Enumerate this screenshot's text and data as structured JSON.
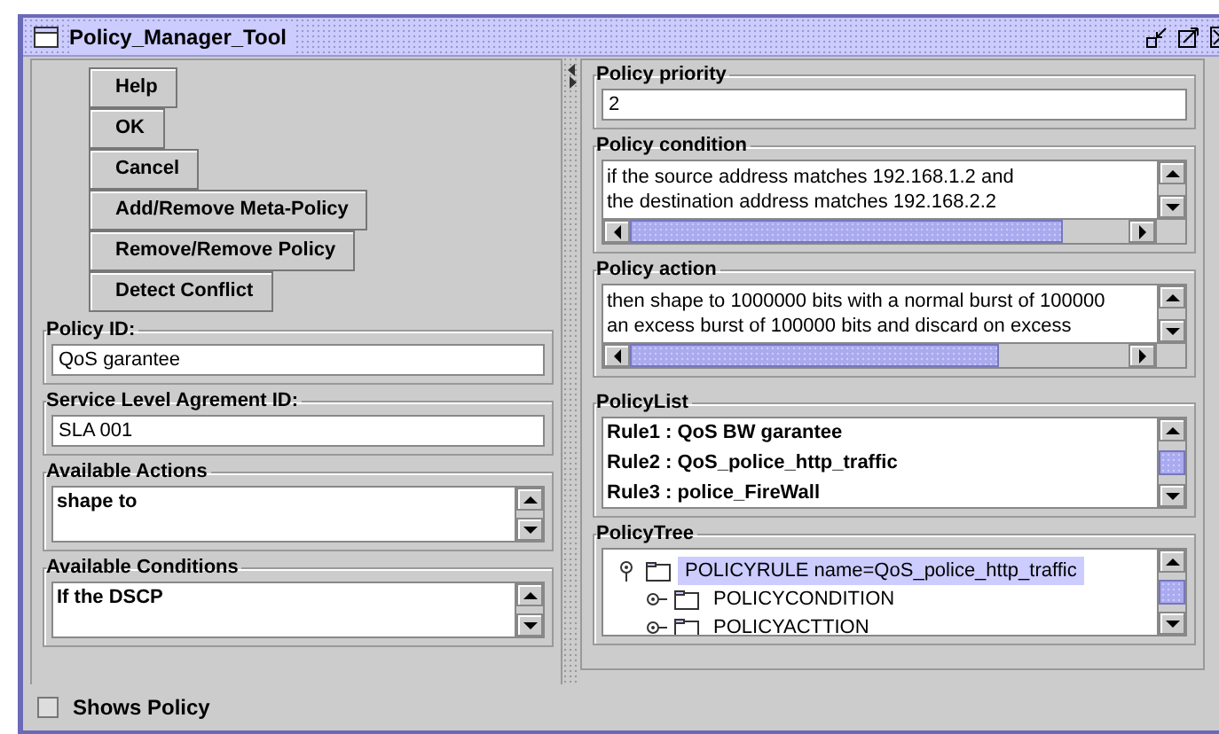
{
  "window": {
    "title": "Policy_Manager_Tool"
  },
  "buttons": [
    {
      "label": "Help"
    },
    {
      "label": "OK"
    },
    {
      "label": "Cancel"
    },
    {
      "label": "Add/Remove Meta-Policy"
    },
    {
      "label": "Remove/Remove Policy"
    },
    {
      "label": "Detect Conflict"
    }
  ],
  "policy_id": {
    "label": "Policy ID:",
    "value": "QoS garantee"
  },
  "sla_id": {
    "label": "Service Level Agrement ID:",
    "value": "SLA 001"
  },
  "available_actions": {
    "label": "Available Actions",
    "items": [
      "shape to"
    ]
  },
  "available_conditions": {
    "label": "Available Conditions",
    "items": [
      "If the DSCP"
    ]
  },
  "policy_priority": {
    "label": "Policy priority",
    "value": "2"
  },
  "policy_condition": {
    "label": "Policy condition",
    "lines": [
      "if the source address matches 192.168.1.2 and",
      "the destination address matches 192.168.2.2"
    ]
  },
  "policy_action": {
    "label": "Policy action",
    "lines": [
      "then shape to 1000000 bits with a normal burst of 100000",
      "an excess burst of 100000 bits and discard on excess"
    ]
  },
  "policy_list": {
    "label": "PolicyList",
    "items": [
      {
        "text": "Rule1 : QoS BW garantee",
        "selected": false
      },
      {
        "text": "Rule2 : QoS_police_http_traffic",
        "selected": false
      },
      {
        "text": "Rule3 : police_FireWall",
        "selected": false
      }
    ]
  },
  "policy_tree": {
    "label": "PolicyTree",
    "nodes": [
      {
        "label": "POLICYRULE name=QoS_police_http_traffic",
        "selected": true,
        "expanded": true,
        "children": [
          {
            "label": "POLICYCONDITION",
            "selected": false,
            "expanded": false
          },
          {
            "label": "POLICYACTTION",
            "selected": false,
            "expanded": false
          }
        ]
      }
    ]
  },
  "shows_policy": {
    "label": "Shows Policy",
    "checked": false
  }
}
